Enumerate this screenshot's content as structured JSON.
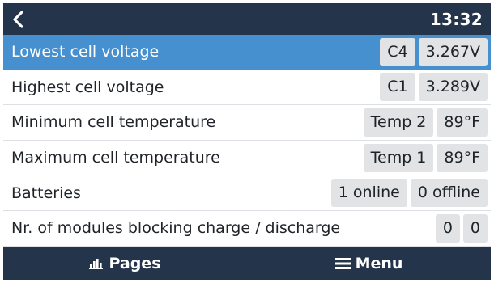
{
  "header": {
    "time": "13:32"
  },
  "rows": [
    {
      "label": "Lowest cell voltage",
      "values": [
        "C4",
        "3.267V"
      ]
    },
    {
      "label": "Highest cell voltage",
      "values": [
        "C1",
        "3.289V"
      ]
    },
    {
      "label": "Minimum cell temperature",
      "values": [
        "Temp 2",
        "89°F"
      ]
    },
    {
      "label": "Maximum cell temperature",
      "values": [
        "Temp 1",
        "89°F"
      ]
    },
    {
      "label": "Batteries",
      "values": [
        "1 online",
        "0 offline"
      ]
    },
    {
      "label": "Nr. of modules blocking charge / discharge",
      "values": [
        "0",
        "0"
      ]
    }
  ],
  "footer": {
    "pages_label": "Pages",
    "menu_label": "Menu"
  },
  "colors": {
    "bar": "#24344a",
    "selected": "#4790d0",
    "value_box": "#e1e3e5"
  },
  "icons": {
    "back": "chevron-left-icon",
    "pages": "bar-chart-icon",
    "menu": "hamburger-icon"
  }
}
